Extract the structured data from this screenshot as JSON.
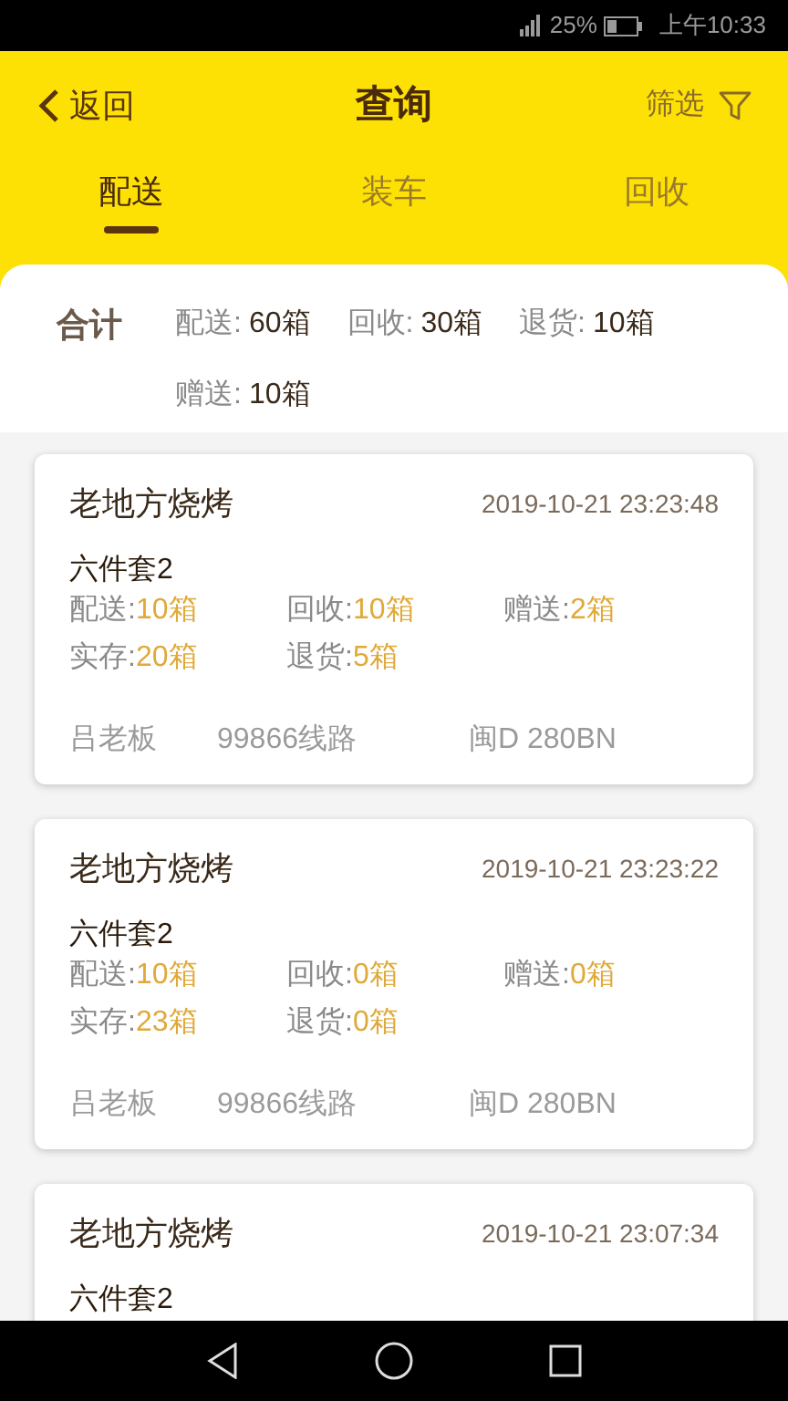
{
  "status_bar": {
    "battery": "25%",
    "time": "上午10:33"
  },
  "header": {
    "back": "返回",
    "title": "查询",
    "filter": "筛选"
  },
  "tabs": [
    {
      "label": "配送",
      "selected": true
    },
    {
      "label": "装车",
      "selected": false
    },
    {
      "label": "回收",
      "selected": false
    }
  ],
  "summary": {
    "label": "合计",
    "items": [
      {
        "label": "配送:",
        "value": "60箱"
      },
      {
        "label": "回收:",
        "value": "30箱"
      },
      {
        "label": "退货:",
        "value": "10箱"
      },
      {
        "label": "赠送:",
        "value": "10箱"
      }
    ]
  },
  "records": [
    {
      "shop": "老地方烧烤",
      "time": "2019-10-21 23:23:48",
      "product": "六件套2",
      "stats": [
        {
          "label": "配送:",
          "value": "10箱"
        },
        {
          "label": "回收:",
          "value": "10箱"
        },
        {
          "label": "赠送:",
          "value": "2箱"
        },
        {
          "label": "实存:",
          "value": "20箱"
        },
        {
          "label": "退货:",
          "value": "5箱"
        }
      ],
      "footer": [
        "吕老板",
        "99866线路",
        "闽D 280BN"
      ]
    },
    {
      "shop": "老地方烧烤",
      "time": "2019-10-21 23:23:22",
      "product": "六件套2",
      "stats": [
        {
          "label": "配送:",
          "value": "10箱"
        },
        {
          "label": "回收:",
          "value": "0箱"
        },
        {
          "label": "赠送:",
          "value": "0箱"
        },
        {
          "label": "实存:",
          "value": "23箱"
        },
        {
          "label": "退货:",
          "value": "0箱"
        }
      ],
      "footer": [
        "吕老板",
        "99866线路",
        "闽D 280BN"
      ]
    },
    {
      "shop": "老地方烧烤",
      "time": "2019-10-21 23:07:34",
      "product": "六件套2"
    }
  ]
}
